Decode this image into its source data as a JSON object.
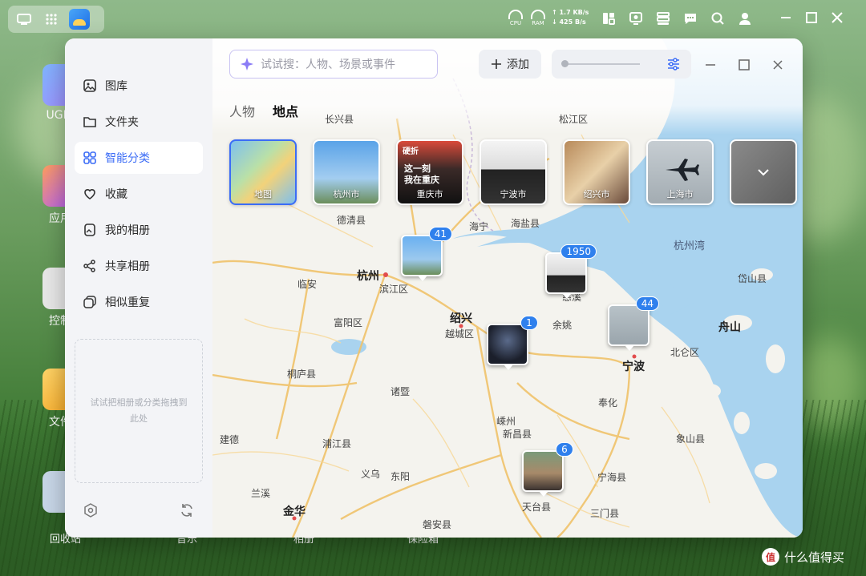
{
  "taskbar": {
    "cpu_label": "CPU",
    "ram_label": "RAM",
    "net_up": "↑ 1.7 KB/s",
    "net_down": "↓ 425 B/s"
  },
  "desktop": {
    "icons": [
      "UGRI",
      "应用",
      "控制",
      "文件"
    ],
    "dock": [
      "回收站",
      "音乐",
      "相册",
      "保险箱"
    ]
  },
  "sidebar": {
    "items": [
      {
        "label": "图库",
        "icon": "gallery-icon"
      },
      {
        "label": "文件夹",
        "icon": "folder-icon"
      },
      {
        "label": "智能分类",
        "icon": "grid-icon"
      },
      {
        "label": "收藏",
        "icon": "heart-icon"
      },
      {
        "label": "我的相册",
        "icon": "album-icon"
      },
      {
        "label": "共享相册",
        "icon": "share-icon"
      },
      {
        "label": "相似重复",
        "icon": "duplicate-icon"
      }
    ],
    "active_index": 2,
    "dropzone_text": "试试把相册或分类拖拽到此处"
  },
  "toolbar": {
    "search_placeholder": "试试搜：人物、场景或事件",
    "add_label": "添加"
  },
  "tabs": [
    {
      "label": "人物",
      "active": false
    },
    {
      "label": "地点",
      "active": true
    }
  ],
  "places": [
    {
      "label": "地图",
      "selected": true
    },
    {
      "label": "杭州市",
      "selected": false
    },
    {
      "label": "重庆市",
      "selected": false,
      "overlay_text": "这一刻\n我在重庆",
      "sign_text": "硬折"
    },
    {
      "label": "宁波市",
      "selected": false
    },
    {
      "label": "绍兴市",
      "selected": false
    },
    {
      "label": "上海市",
      "selected": false
    }
  ],
  "map": {
    "labels": {
      "changxing": "长兴县",
      "songjiang": "松江区",
      "deqing": "德清县",
      "haining": "海宁",
      "haiyan": "海盐县",
      "hangzhouwan": "杭州湾",
      "linan": "临安",
      "hangzhou": "杭州",
      "binjiang": "滨江区",
      "shaoxing": "绍兴",
      "yuecheng": "越城区",
      "fuyang": "富阳区",
      "yuyao": "余姚",
      "cixi": "慈溪",
      "beilun": "北仑区",
      "ningbo": "宁波",
      "zhoushan": "舟山",
      "daishan": "岱山县",
      "tonglu": "桐庐县",
      "zhuji": "诸暨",
      "fenghua": "奉化",
      "shengzhou": "嵊州",
      "xinchang": "新昌县",
      "xiangshan": "象山县",
      "jiande": "建德",
      "pujiang": "浦江县",
      "yiwu": "义乌",
      "dongyang": "东阳",
      "ninghai": "宁海县",
      "lanxi": "兰溪",
      "jinhua": "金华",
      "tiantai": "天台县",
      "sanmen": "三门县",
      "panan": "磐安县"
    },
    "pins": [
      {
        "name": "hangzhou",
        "count": "41"
      },
      {
        "name": "cixi",
        "count": "1950"
      },
      {
        "name": "ningbo",
        "count": "44"
      },
      {
        "name": "shaoxing",
        "count": "1"
      },
      {
        "name": "tiantai",
        "count": "6"
      }
    ]
  },
  "watermark": "什么值得买",
  "colors": {
    "accent": "#3b6cf6",
    "badge": "#2f80ed"
  }
}
